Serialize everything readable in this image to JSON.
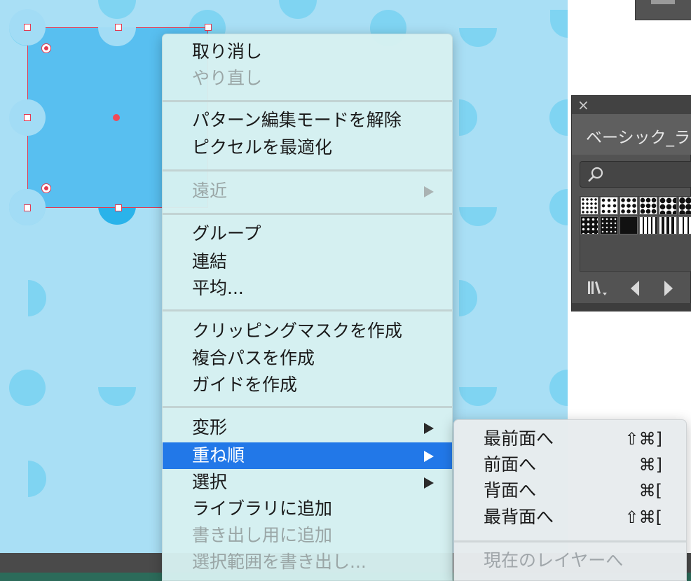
{
  "context_menu": {
    "groups": [
      [
        {
          "label": "取り消し",
          "enabled": true
        },
        {
          "label": "やり直し",
          "enabled": false
        }
      ],
      [
        {
          "label": "パターン編集モードを解除",
          "enabled": true
        },
        {
          "label": "ピクセルを最適化",
          "enabled": true
        }
      ],
      [
        {
          "label": "遠近",
          "enabled": false,
          "submenu": true
        }
      ],
      [
        {
          "label": "グループ",
          "enabled": true
        },
        {
          "label": "連結",
          "enabled": true
        },
        {
          "label": "平均...",
          "enabled": true
        }
      ],
      [
        {
          "label": "クリッピングマスクを作成",
          "enabled": true
        },
        {
          "label": "複合パスを作成",
          "enabled": true
        },
        {
          "label": "ガイドを作成",
          "enabled": true
        }
      ],
      [
        {
          "label": "変形",
          "enabled": true,
          "submenu": true
        },
        {
          "label": "重ね順",
          "enabled": true,
          "submenu": true,
          "highlighted": true
        },
        {
          "label": "選択",
          "enabled": true,
          "submenu": true
        },
        {
          "label": "ライブラリに追加",
          "enabled": true
        },
        {
          "label": "書き出し用に追加",
          "enabled": false
        },
        {
          "label": "選択範囲を書き出し...",
          "enabled": false
        }
      ]
    ]
  },
  "arrange_submenu": {
    "items": [
      {
        "label": "最前面へ",
        "shortcut": "⇧⌘]",
        "enabled": true
      },
      {
        "label": "前面へ",
        "shortcut": "⌘]",
        "enabled": true
      },
      {
        "label": "背面へ",
        "shortcut": "⌘[",
        "enabled": true
      },
      {
        "label": "最背面へ",
        "shortcut": "⇧⌘[",
        "enabled": true
      }
    ],
    "layer_item": {
      "label": "現在のレイヤーへ",
      "enabled": false
    }
  },
  "library_panel": {
    "close_glyph": "×",
    "title": "ベーシック_ライ"
  },
  "colors": {
    "canvas_bg": "#a9dff5",
    "pattern": "#7fd4f2",
    "selection": "#e23a52",
    "highlight": "#2278e8"
  }
}
